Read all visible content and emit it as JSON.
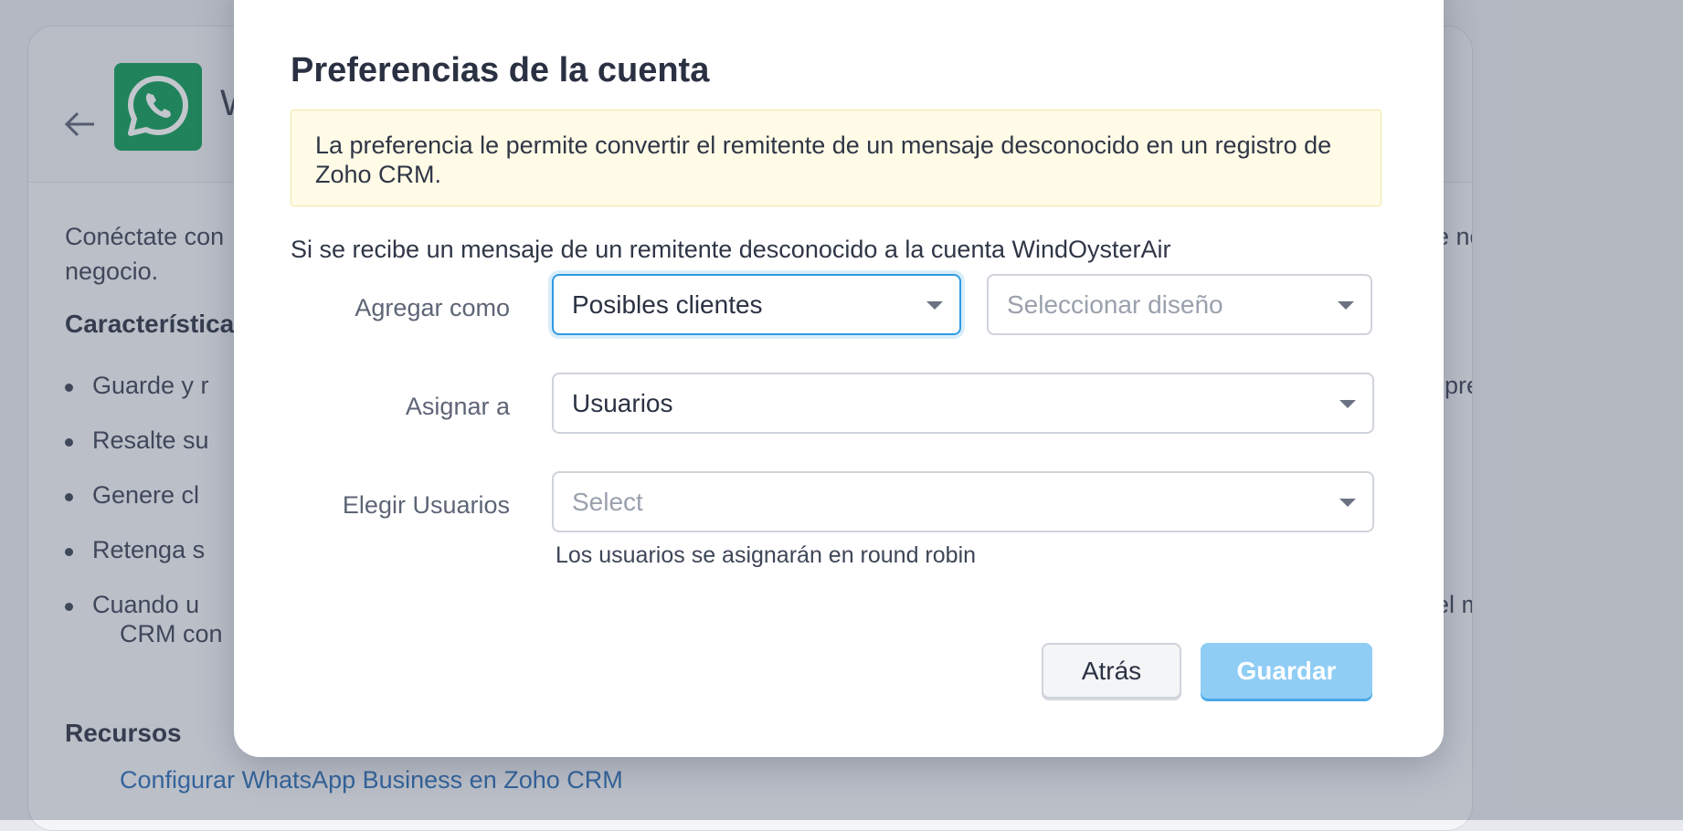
{
  "background": {
    "app_title_initial": "W",
    "intro_line1_start": "Conéctate con",
    "intro_line1_end": "e notificaciones imp",
    "intro_line2": "negocio.",
    "features_heading": "Característica",
    "bullets": [
      {
        "left": "Guarde y r",
        "right": "preguntas habituales"
      },
      {
        "left": "Resalte su",
        "right": ""
      },
      {
        "left": "Genere cl",
        "right": ""
      },
      {
        "left": "Retenga s",
        "right": ""
      },
      {
        "left": "Cuando u",
        "right": "el mensaje y respond"
      }
    ],
    "bullet5_line2": "CRM con",
    "resources_heading": "Recursos",
    "resources_link": "Configurar WhatsApp Business en Zoho CRM"
  },
  "modal": {
    "title": "Preferencias de la cuenta",
    "notice": "La preferencia le permite convertir el remitente de un mensaje desconocido en un registro de Zoho CRM.",
    "intro": "Si se recibe un mensaje de un remitente desconocido a la cuenta WindOysterAir",
    "fields": {
      "add_as": {
        "label": "Agregar como",
        "value": "Posibles clientes",
        "layout_placeholder": "Seleccionar diseño"
      },
      "assign_to": {
        "label": "Asignar a",
        "value": "Usuarios"
      },
      "choose_users": {
        "label": "Elegir Usuarios",
        "placeholder": "Select",
        "hint": "Los usuarios se asignarán en round robin"
      }
    },
    "buttons": {
      "back": "Atrás",
      "save": "Guardar"
    }
  },
  "colors": {
    "accent": "#2f9ae4",
    "save_button": "#8fcdf5",
    "notice_bg": "#fffbe6",
    "whatsapp_green": "#0f9d58"
  }
}
